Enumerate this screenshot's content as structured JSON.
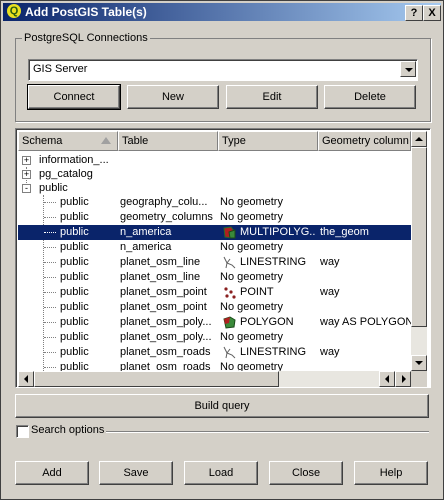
{
  "window": {
    "title": "Add PostGIS Table(s)",
    "help_btn": "?",
    "close_btn": "X"
  },
  "connections": {
    "group_label": "PostgreSQL Connections",
    "selected": "GIS Server",
    "buttons": {
      "connect": "Connect",
      "new": "New",
      "edit": "Edit",
      "delete": "Delete"
    }
  },
  "table": {
    "headers": [
      "Schema",
      "Table",
      "Type",
      "Geometry column"
    ],
    "tree_nodes": [
      {
        "label": "information_...",
        "expander": "+"
      },
      {
        "label": "pg_catalog",
        "expander": "+"
      },
      {
        "label": "public",
        "expander": "-"
      }
    ],
    "rows": [
      {
        "schema": "public",
        "table": "geography_colu...",
        "type": "No geometry",
        "geom": "",
        "icon": ""
      },
      {
        "schema": "public",
        "table": "geometry_columns",
        "type": "No geometry",
        "geom": "",
        "icon": ""
      },
      {
        "schema": "public",
        "table": "n_america",
        "type": "MULTIPOLYG...",
        "geom": "the_geom",
        "icon": "multipolygon-icon",
        "selected": true
      },
      {
        "schema": "public",
        "table": "n_america",
        "type": "No geometry",
        "geom": "",
        "icon": ""
      },
      {
        "schema": "public",
        "table": "planet_osm_line",
        "type": "LINESTRING",
        "geom": "way",
        "icon": "linestring-icon"
      },
      {
        "schema": "public",
        "table": "planet_osm_line",
        "type": "No geometry",
        "geom": "",
        "icon": ""
      },
      {
        "schema": "public",
        "table": "planet_osm_point",
        "type": "POINT",
        "geom": "way",
        "icon": "point-icon"
      },
      {
        "schema": "public",
        "table": "planet_osm_point",
        "type": "No geometry",
        "geom": "",
        "icon": ""
      },
      {
        "schema": "public",
        "table": "planet_osm_poly...",
        "type": "POLYGON",
        "geom": "way AS POLYGON",
        "icon": "polygon-icon"
      },
      {
        "schema": "public",
        "table": "planet_osm_poly...",
        "type": "No geometry",
        "geom": "",
        "icon": ""
      },
      {
        "schema": "public",
        "table": "planet_osm_roads",
        "type": "LINESTRING",
        "geom": "way",
        "icon": "linestring-icon"
      },
      {
        "schema": "public",
        "table": "planet_osm_roads",
        "type": "No geometry",
        "geom": "",
        "icon": ""
      }
    ]
  },
  "build_query": "Build query",
  "search_options": "Search options",
  "footer": {
    "add": "Add",
    "save": "Save",
    "load": "Load",
    "close": "Close",
    "help": "Help"
  },
  "colors": {
    "selection": "#0a246a",
    "titlebar": "#0a246a",
    "face": "#d4d0c8"
  }
}
